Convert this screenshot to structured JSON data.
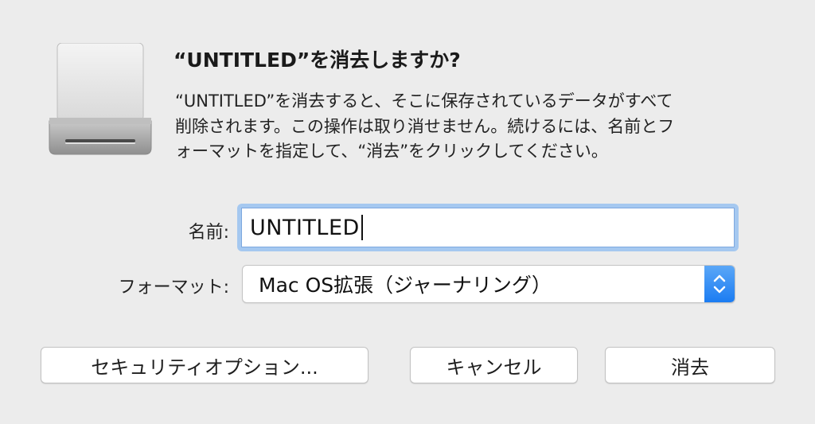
{
  "dialog": {
    "title": "“UNTITLED”を消去しますか?",
    "message_lines": [
      "“UNTITLED”を消去すると、そこに保存されているデータがすべて",
      "削除されます。この操作は取り消せません。続けるには、名前とフ",
      "ォーマットを指定して、“消去”をクリックしてください。"
    ],
    "disk_icon": "external-disk-icon"
  },
  "form": {
    "name_label": "名前:",
    "name_value": "UNTITLED",
    "format_label": "フォーマット:",
    "format_value": "Mac OS拡張（ジャーナリング）",
    "stepper_icon": "up-down-chevron-icon"
  },
  "buttons": {
    "security_options": "セキュリティオプション...",
    "cancel": "キャンセル",
    "erase": "消去"
  },
  "colors": {
    "focus_ring": "#a5c8f0",
    "stepper_accent": "#1b7cf2",
    "background": "#ececec"
  }
}
